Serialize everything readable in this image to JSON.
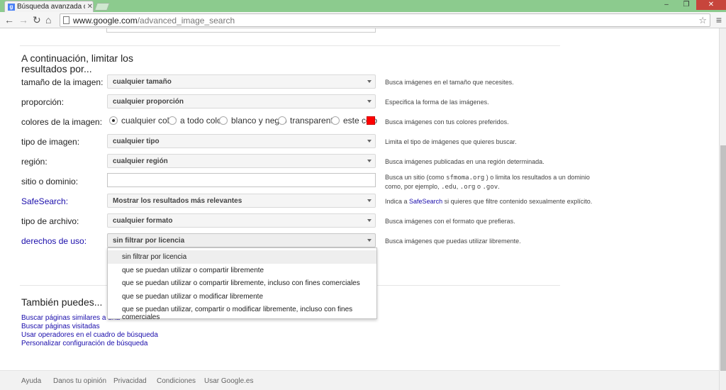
{
  "browser": {
    "tab_title": "Búsqueda avanzada de im",
    "tab_favicon": "g",
    "url_host": "www.google.com",
    "url_path": "/advanced_image_search"
  },
  "limit_section": {
    "heading_line1": "A continuación, limitar los",
    "heading_line2": "resultados por...",
    "rows": {
      "size": {
        "label": "tamaño de la imagen:",
        "value": "cualquier tamaño",
        "help": "Busca imágenes en el tamaño que necesites."
      },
      "aspect": {
        "label": "proporción:",
        "value": "cualquier proporción",
        "help": "Especifica la forma de las imágenes."
      },
      "colors": {
        "label": "colores de la imagen:",
        "options": [
          "cualquier color",
          "a todo color",
          "blanco y negro",
          "transparente",
          "este colo"
        ],
        "selected": "cualquier color",
        "swatch_color": "#ff0000",
        "help": "Busca imágenes con tus colores preferidos."
      },
      "type": {
        "label": "tipo de imagen:",
        "value": "cualquier tipo",
        "help": "Limita el tipo de imágenes que quieres buscar."
      },
      "region": {
        "label": "región:",
        "value": "cualquier región",
        "help": "Busca imágenes publicadas en una región determinada."
      },
      "site": {
        "label": "sitio o dominio:",
        "help_line1_a": "Busca un sitio (como",
        "help_line1_code": "sfmoma.org",
        "help_line1_b": ") o limita los resultados a un dominio",
        "help_line2_a": "como, por ejemplo,",
        "help_line2_code1": ".edu",
        "help_line2_sep1": ",",
        "help_line2_code2": ".org",
        "help_line2_sep2": "o",
        "help_line2_code3": ".gov",
        "help_line2_end": "."
      },
      "safesearch": {
        "label": "SafeSearch:",
        "value": "Mostrar los resultados más relevantes",
        "help_a": "Indica a",
        "help_link": "SafeSearch",
        "help_b": "si quieres que filtre contenido sexualmente explícito."
      },
      "filetype": {
        "label": "tipo de archivo:",
        "value": "cualquier formato",
        "help": "Busca imágenes con el formato que prefieras."
      },
      "rights": {
        "label": "derechos de uso:",
        "value": "sin filtrar por licencia",
        "help": "Busca imágenes que puedas utilizar libremente."
      }
    }
  },
  "rights_dropdown": {
    "options": [
      "sin filtrar por licencia",
      "que se puedan utilizar o compartir libremente",
      "que se puedan utilizar o compartir libremente, incluso con fines comerciales",
      "que se puedan utilizar o modificar libremente",
      "que se puedan utilizar, compartir o modificar libremente, incluso con fines comerciales"
    ],
    "selected_index": 0
  },
  "also_section": {
    "heading": "También puedes...",
    "links": [
      "Buscar páginas similares a una",
      "Buscar páginas visitadas",
      "Usar operadores en el cuadro de búsqueda",
      "Personalizar configuración de búsqueda"
    ]
  },
  "footer": {
    "links": [
      "Ayuda",
      "Danos tu opinión",
      "Privacidad",
      "Condiciones",
      "Usar Google.es"
    ]
  }
}
